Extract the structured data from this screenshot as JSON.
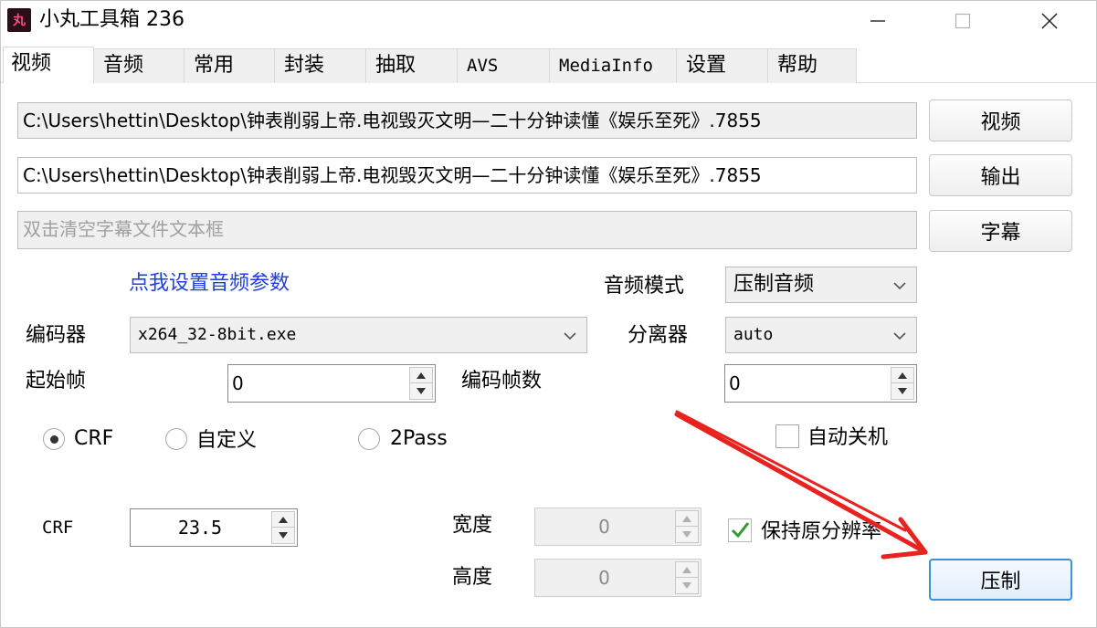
{
  "window": {
    "app_icon_text": "丸",
    "title": "小丸工具箱 236"
  },
  "tabs": [
    {
      "label": "视频",
      "active": true
    },
    {
      "label": "音频",
      "active": false
    },
    {
      "label": "常用",
      "active": false
    },
    {
      "label": "封装",
      "active": false
    },
    {
      "label": "抽取",
      "active": false
    },
    {
      "label": "AVS",
      "active": false
    },
    {
      "label": "MediaInfo",
      "active": false
    },
    {
      "label": "设置",
      "active": false
    },
    {
      "label": "帮助",
      "active": false
    }
  ],
  "video": {
    "input_path": "C:\\Users\\hettin\\Desktop\\钟表削弱上帝.电视毁灭文明—二十分钟读懂《娱乐至死》.7855",
    "output_path": "C:\\Users\\hettin\\Desktop\\钟表削弱上帝.电视毁灭文明—二十分钟读懂《娱乐至死》.7855",
    "subtitle_placeholder": "双击清空字幕文件文本框",
    "video_button": "视频",
    "output_button": "输出",
    "subtitle_button": "字幕",
    "audio_settings_link": "点我设置音频参数",
    "audio_mode_label": "音频模式",
    "audio_mode_value": "压制音频",
    "encoder_label": "编码器",
    "encoder_value": "x264_32-8bit.exe",
    "splitter_label": "分离器",
    "splitter_value": "auto",
    "start_frame_label": "起始帧",
    "start_frame_value": "0",
    "encode_frames_label": "编码帧数",
    "encode_frames_value": "0",
    "mode_crf_label": "CRF",
    "mode_custom_label": "自定义",
    "mode_2pass_label": "2Pass",
    "auto_shutdown_label": "自动关机",
    "crf_label": "CRF",
    "crf_value": "23.5",
    "width_label": "宽度",
    "width_value": "0",
    "height_label": "高度",
    "height_value": "0",
    "keep_resolution_label": "保持原分辨率",
    "encode_button": "压制"
  },
  "colors": {
    "link": "#1f3fe0",
    "annotation_arrow": "#e8221e",
    "primary_button_border": "#3f8fd9",
    "checkmark": "#2f9b2f"
  }
}
